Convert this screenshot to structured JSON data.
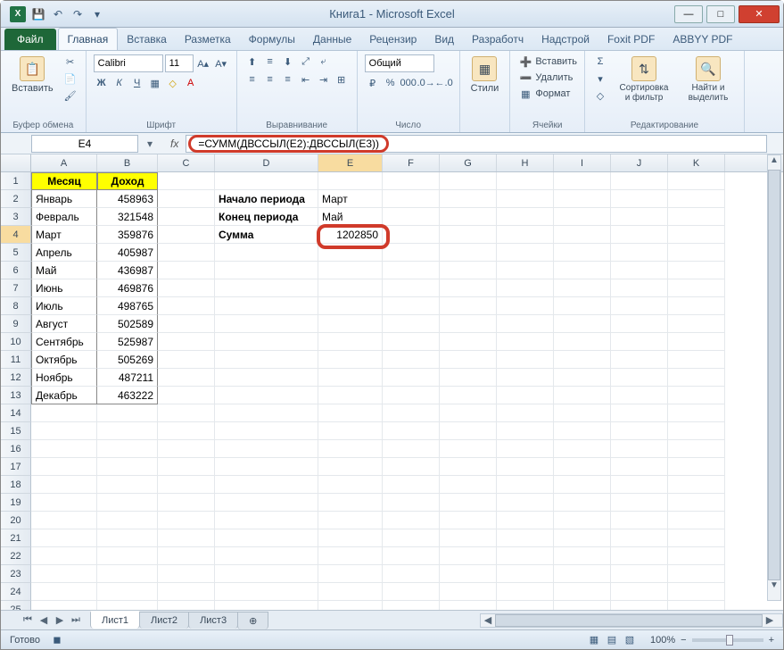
{
  "window": {
    "title": "Книга1 - Microsoft Excel"
  },
  "qat": {
    "save": "💾",
    "undo": "↶",
    "redo": "↷"
  },
  "tabs": {
    "file": "Файл",
    "items": [
      "Главная",
      "Вставка",
      "Разметка",
      "Формулы",
      "Данные",
      "Рецензир",
      "Вид",
      "Разработч",
      "Надстрой",
      "Foxit PDF",
      "ABBYY PDF"
    ],
    "active": 0
  },
  "ribbon": {
    "clipboard": {
      "paste": "Вставить",
      "label": "Буфер обмена"
    },
    "font": {
      "name": "Calibri",
      "size": "11",
      "label": "Шрифт"
    },
    "align": {
      "label": "Выравнивание"
    },
    "number": {
      "format": "Общий",
      "label": "Число"
    },
    "styles": {
      "btn": "Стили",
      "label": ""
    },
    "cells": {
      "insert": "Вставить",
      "delete": "Удалить",
      "format": "Формат",
      "label": "Ячейки"
    },
    "editing": {
      "sort": "Сортировка и фильтр",
      "find": "Найти и выделить",
      "label": "Редактирование"
    }
  },
  "namebox": "E4",
  "formula": "=СУММ(ДВССЫЛ(E2):ДВССЫЛ(E3))",
  "columns": [
    "A",
    "B",
    "C",
    "D",
    "E",
    "F",
    "G",
    "H",
    "I",
    "J",
    "K"
  ],
  "headers": {
    "A": "Месяц",
    "B": "Доход"
  },
  "months": [
    {
      "m": "Январь",
      "v": "458963"
    },
    {
      "m": "Февраль",
      "v": "321548"
    },
    {
      "m": "Март",
      "v": "359876"
    },
    {
      "m": "Апрель",
      "v": "405987"
    },
    {
      "m": "Май",
      "v": "436987"
    },
    {
      "m": "Июнь",
      "v": "469876"
    },
    {
      "m": "Июль",
      "v": "498765"
    },
    {
      "m": "Август",
      "v": "502589"
    },
    {
      "m": "Сентябрь",
      "v": "525987"
    },
    {
      "m": "Октябрь",
      "v": "505269"
    },
    {
      "m": "Ноябрь",
      "v": "487211"
    },
    {
      "m": "Декабрь",
      "v": "463222"
    }
  ],
  "labels": {
    "start": "Начало периода",
    "start_v": "Март",
    "end": "Конец периода",
    "end_v": "Май",
    "sum": "Сумма",
    "sum_v": "1202850"
  },
  "sheets": [
    "Лист1",
    "Лист2",
    "Лист3"
  ],
  "status": {
    "ready": "Готово",
    "zoom": "100%"
  }
}
